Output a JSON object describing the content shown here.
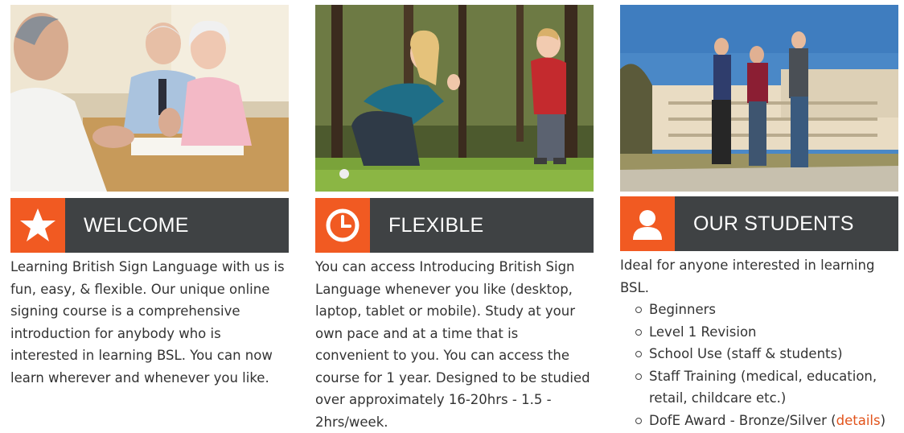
{
  "colors": {
    "accent": "#f15a22",
    "banner": "#3f4244",
    "link": "#e2531b"
  },
  "columns": [
    {
      "icon": "star-icon",
      "title": "WELCOME",
      "text": "Learning British Sign Language with us is fun, easy, & flexible. Our unique online signing course is a comprehensive introduction for anybody who is interested in learning BSL. You can now learn wherever and whenever you like."
    },
    {
      "icon": "clock-icon",
      "title": "FLEXIBLE",
      "text": "You can access Introducing British Sign Language whenever you like (desktop, laptop, tablet or mobile). Study at your own pace and at a time that is convenient to you. You can access the course for 1 year. Designed to be studied over approximately 16-20hrs - 1.5 - 2hrs/week."
    },
    {
      "icon": "person-icon",
      "title": "OUR STUDENTS",
      "intro": "Ideal for anyone interested in learning BSL.",
      "items": [
        "Beginners",
        "Level 1 Revision",
        "School Use (staff & students)",
        "Staff Training (medical, education, retail, childcare etc.)"
      ],
      "last_item_prefix": "DofE Award - Bronze/Silver (",
      "last_item_link": "details",
      "last_item_suffix": ")"
    }
  ]
}
